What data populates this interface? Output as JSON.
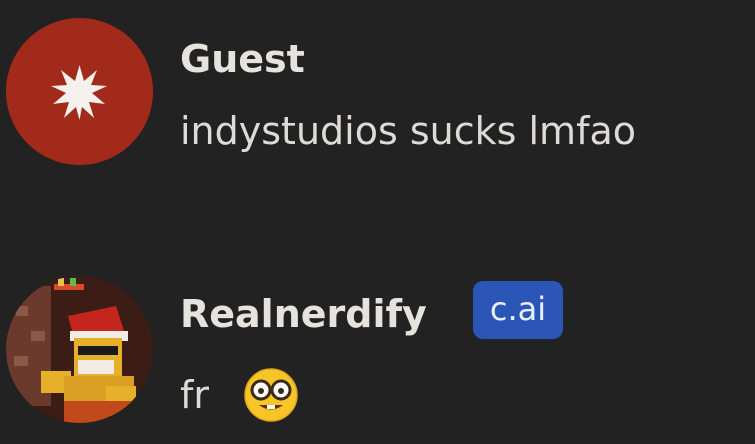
{
  "messages": [
    {
      "author": "Guest",
      "text": "indystudios sucks lmfao",
      "avatar_icon": "asterisk-icon",
      "avatar_color": "#a22a1a"
    },
    {
      "author": "Realnerdify",
      "badge": "c.ai",
      "text": "fr",
      "emoji": "nerd-face",
      "badge_color": "#2b56b8"
    }
  ]
}
